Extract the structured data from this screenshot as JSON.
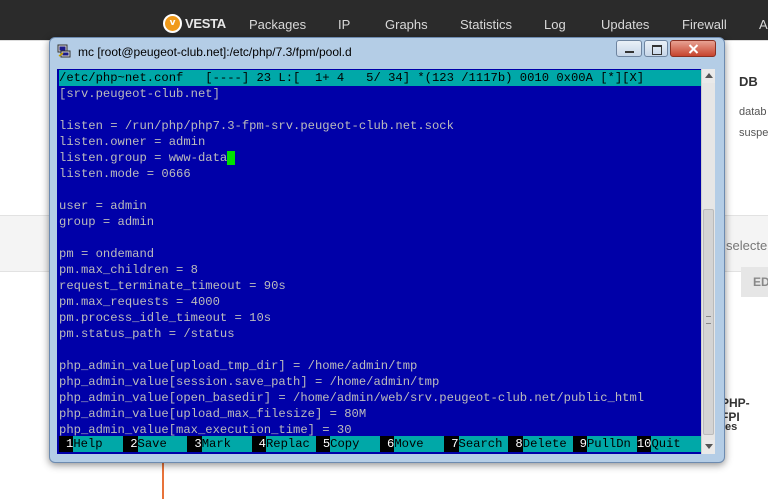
{
  "vesta": {
    "logo_text": "VESTA",
    "nav": [
      "Packages",
      "IP",
      "Graphs",
      "Statistics",
      "Log",
      "Updates",
      "Firewall",
      "A"
    ],
    "db_heading": "DB",
    "side_lines": [
      "datab",
      "suspe"
    ],
    "select_text": "selecte",
    "ed_button": "ED",
    "php_fpm": "PHP-FPI",
    "es_text": "es"
  },
  "window": {
    "title": "mc [root@peugeot-club.net]:/etc/php/7.3/fpm/pool.d"
  },
  "editor": {
    "status_line": "/etc/php~net.conf   [----] 23 L:[  1+ 4   5/ 34] *(123 /1117b) 0010 0x00A [*][X]",
    "lines": [
      "[srv.peugeot-club.net]",
      "",
      "listen = /run/php/php7.3-fpm-srv.peugeot-club.net.sock",
      "listen.owner = admin",
      "listen.group = www-data",
      "listen.mode = 0666",
      "",
      "user = admin",
      "group = admin",
      "",
      "pm = ondemand",
      "pm.max_children = 8",
      "request_terminate_timeout = 90s",
      "pm.max_requests = 4000",
      "pm.process_idle_timeout = 10s",
      "pm.status_path = /status",
      "",
      "php_admin_value[upload_tmp_dir] = /home/admin/tmp",
      "php_admin_value[session.save_path] = /home/admin/tmp",
      "php_admin_value[open_basedir] = /home/admin/web/srv.peugeot-club.net/public_html",
      "php_admin_value[upload_max_filesize] = 80M",
      "php_admin_value[max_execution_time] = 30"
    ],
    "cursor_line_index": 4
  },
  "fkeys": [
    {
      "num": "1",
      "label": "Help"
    },
    {
      "num": "2",
      "label": "Save"
    },
    {
      "num": "3",
      "label": "Mark"
    },
    {
      "num": "4",
      "label": "Replac"
    },
    {
      "num": "5",
      "label": "Copy"
    },
    {
      "num": "6",
      "label": "Move"
    },
    {
      "num": "7",
      "label": "Search"
    },
    {
      "num": "8",
      "label": "Delete"
    },
    {
      "num": "9",
      "label": "PullDn"
    },
    {
      "num": "10",
      "label": "Quit"
    }
  ],
  "colors": {
    "terminal_bg": "#0000a8",
    "terminal_fg": "#bcbcbc",
    "status_bg": "#00a8a8",
    "cursor": "#00e000",
    "vesta_accent": "#f09a1a"
  }
}
